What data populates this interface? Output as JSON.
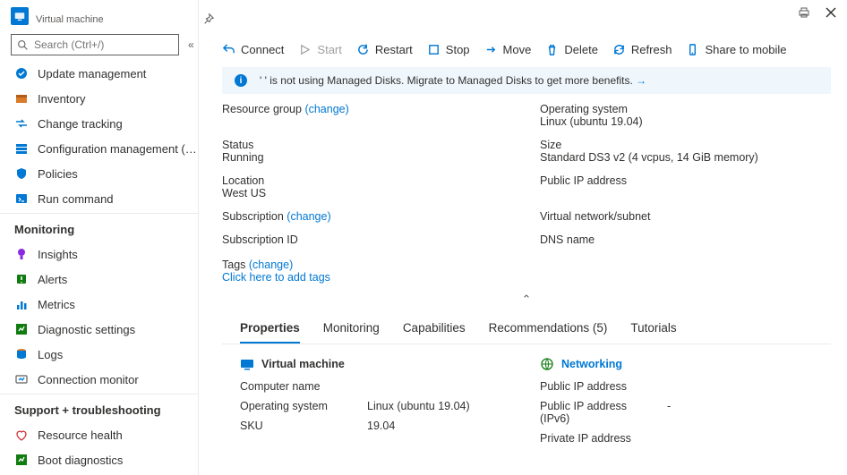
{
  "header": {
    "title": "Virtual machine",
    "search_placeholder": "Search (Ctrl+/)"
  },
  "sidebar": {
    "items_top": [
      {
        "icon": "update",
        "label": "Update management"
      },
      {
        "icon": "inventory",
        "label": "Inventory"
      },
      {
        "icon": "change",
        "label": "Change tracking"
      },
      {
        "icon": "config",
        "label": "Configuration management (…"
      },
      {
        "icon": "policy",
        "label": "Policies"
      },
      {
        "icon": "run",
        "label": "Run command"
      }
    ],
    "section_monitoring": "Monitoring",
    "items_monitoring": [
      {
        "icon": "insights",
        "label": "Insights"
      },
      {
        "icon": "alerts",
        "label": "Alerts"
      },
      {
        "icon": "metrics",
        "label": "Metrics"
      },
      {
        "icon": "diag",
        "label": "Diagnostic settings"
      },
      {
        "icon": "logs",
        "label": "Logs"
      },
      {
        "icon": "cmon",
        "label": "Connection monitor"
      }
    ],
    "section_support": "Support + troubleshooting",
    "items_support": [
      {
        "icon": "health",
        "label": "Resource health"
      },
      {
        "icon": "boot",
        "label": "Boot diagnostics"
      }
    ]
  },
  "toolbar": {
    "connect": "Connect",
    "start": "Start",
    "restart": "Restart",
    "stop": "Stop",
    "move": "Move",
    "delete": "Delete",
    "refresh": "Refresh",
    "share": "Share to mobile"
  },
  "banner": {
    "prefix": "'",
    "text": "' is not using Managed Disks. Migrate to Managed Disks to get more benefits."
  },
  "essentials": {
    "left": {
      "resource_group_label": "Resource group",
      "resource_group_change": "(change)",
      "status_label": "Status",
      "status_value": "Running",
      "location_label": "Location",
      "location_value": "West US",
      "subscription_label": "Subscription",
      "subscription_change": "(change)",
      "subscription_id_label": "Subscription ID"
    },
    "right": {
      "os_label": "Operating system",
      "os_value": "Linux (ubuntu 19.04)",
      "size_label": "Size",
      "size_value": "Standard DS3 v2 (4 vcpus, 14 GiB memory)",
      "pip_label": "Public IP address",
      "vnet_label": "Virtual network/subnet",
      "dns_label": "DNS name"
    },
    "tags_label": "Tags",
    "tags_change": "(change)",
    "tags_add": "Click here to add tags"
  },
  "tabs": {
    "properties": "Properties",
    "monitoring": "Monitoring",
    "capabilities": "Capabilities",
    "recommendations": "Recommendations (5)",
    "tutorials": "Tutorials"
  },
  "properties_panel": {
    "vm_section": "Virtual machine",
    "net_section": "Networking",
    "rows_left": [
      {
        "k": "Computer name",
        "v": ""
      },
      {
        "k": "Operating system",
        "v": "Linux (ubuntu 19.04)"
      },
      {
        "k": "SKU",
        "v": "19.04"
      }
    ],
    "rows_right": [
      {
        "k": "Public IP address",
        "v": ""
      },
      {
        "k": "Public IP address (IPv6)",
        "v": "-"
      },
      {
        "k": "Private IP address",
        "v": ""
      }
    ]
  }
}
